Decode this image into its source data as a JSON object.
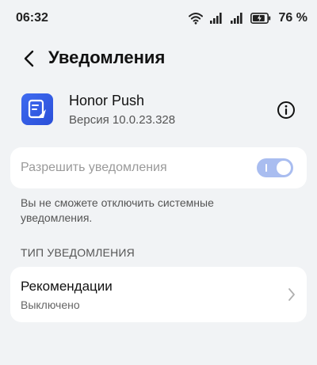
{
  "status_bar": {
    "time": "06:32",
    "battery_percent": "76 %",
    "icons": [
      "wifi-icon",
      "signal-icon",
      "signal-icon",
      "battery-icon"
    ]
  },
  "header": {
    "title": "Уведомления",
    "back_icon": "chevron-left-icon"
  },
  "app": {
    "name": "Honor Push",
    "version": "Версия 10.0.23.328",
    "icon": "honor-push-app-icon",
    "info_icon": "info-icon",
    "icon_color": "#3f6bf0"
  },
  "allow_notifications": {
    "label": "Разрешить уведомления",
    "enabled": true,
    "disabled_state": true,
    "toggle_color": "#a9bdf0"
  },
  "note": "Вы не сможете отключить системные уведомления.",
  "section": {
    "title": "ТИП УВЕДОМЛЕНИЯ"
  },
  "recommendations": {
    "title": "Рекомендации",
    "status": "Выключено",
    "chevron_icon": "chevron-right-icon"
  }
}
